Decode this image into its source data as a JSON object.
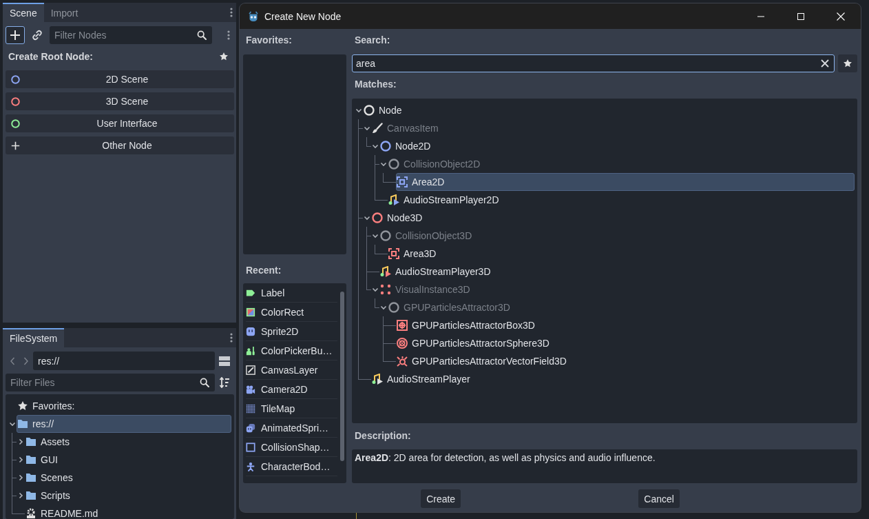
{
  "scene_dock": {
    "tabs": [
      {
        "label": "Scene",
        "selected": true
      },
      {
        "label": "Import",
        "selected": false
      }
    ],
    "add_button": {
      "focused": true
    },
    "filter": {
      "placeholder": "Filter Nodes"
    },
    "heading": "Create Root Node:",
    "root_options": [
      {
        "label": "2D Scene",
        "kind": "circle",
        "color": "#8da5f3"
      },
      {
        "label": "3D Scene",
        "kind": "circle",
        "color": "#fc7f7f"
      },
      {
        "label": "User Interface",
        "kind": "circle",
        "color": "#8eef97"
      },
      {
        "label": "Other Node",
        "kind": "plus"
      }
    ]
  },
  "filesystem_dock": {
    "tabs": [
      {
        "label": "FileSystem",
        "selected": true
      }
    ],
    "path": "res://",
    "filter": {
      "placeholder": "Filter Files"
    },
    "tree": [
      {
        "label": "Favorites:",
        "kind": "star",
        "selected": false
      },
      {
        "label": "res://",
        "kind": "folder",
        "selected": true,
        "expanded": true,
        "children": [
          {
            "label": "Assets",
            "kind": "folder",
            "selected": false,
            "expanded": false
          },
          {
            "label": "GUI",
            "kind": "folder",
            "selected": false,
            "expanded": false
          },
          {
            "label": "Scenes",
            "kind": "folder",
            "selected": false,
            "expanded": false
          },
          {
            "label": "Scripts",
            "kind": "folder",
            "selected": false,
            "expanded": false
          },
          {
            "label": "README.md",
            "kind": "gear",
            "selected": false
          }
        ]
      }
    ]
  },
  "dialog": {
    "title": "Create New Node",
    "favorites_label": "Favorites:",
    "recent_label": "Recent:",
    "recent": [
      {
        "label": "Label",
        "kind": "tag",
        "selected": false
      },
      {
        "label": "ColorRect",
        "kind": "swatch",
        "selected": false
      },
      {
        "label": "Sprite2D",
        "kind": "face",
        "selected": false
      },
      {
        "label": "ColorPickerBu…",
        "kind": "dropper",
        "selected": false
      },
      {
        "label": "CanvasLayer",
        "kind": "pencil",
        "selected": false
      },
      {
        "label": "Camera2D",
        "kind": "camera",
        "selected": false
      },
      {
        "label": "TileMap",
        "kind": "grid",
        "selected": false
      },
      {
        "label": "AnimatedSpri…",
        "kind": "faces",
        "selected": false
      },
      {
        "label": "CollisionShap…",
        "kind": "square",
        "selected": false
      },
      {
        "label": "CharacterBod…",
        "kind": "figure",
        "selected": false
      }
    ],
    "search_label": "Search:",
    "search": {
      "value": "area",
      "focused": true
    },
    "matches_label": "Matches:",
    "matches": [
      {
        "label": "Node",
        "kind": "circle",
        "color": "#e0e0e0",
        "selected": false,
        "disabled": false,
        "expanded": true,
        "children": [
          {
            "label": "CanvasItem",
            "kind": "brush",
            "color": "#e0e0e0",
            "selected": false,
            "disabled": true,
            "expanded": true,
            "children": [
              {
                "label": "Node2D",
                "kind": "circle",
                "color": "#8da5f3",
                "selected": false,
                "disabled": false,
                "expanded": true,
                "children": [
                  {
                    "label": "CollisionObject2D",
                    "kind": "circle",
                    "color": "#90949b",
                    "selected": false,
                    "disabled": true,
                    "expanded": true,
                    "children": [
                      {
                        "label": "Area2D",
                        "kind": "area",
                        "color": "#8da5f3",
                        "selected": true,
                        "disabled": false
                      }
                    ]
                  },
                  {
                    "label": "AudioStreamPlayer2D",
                    "kind": "audio",
                    "color": "#8da5f3",
                    "selected": false,
                    "disabled": false
                  }
                ]
              }
            ]
          },
          {
            "label": "Node3D",
            "kind": "circle",
            "color": "#fc7f7f",
            "selected": false,
            "disabled": false,
            "expanded": true,
            "children": [
              {
                "label": "CollisionObject3D",
                "kind": "circle",
                "color": "#90949b",
                "selected": false,
                "disabled": true,
                "expanded": true,
                "children": [
                  {
                    "label": "Area3D",
                    "kind": "area",
                    "color": "#fc7f7f",
                    "selected": false,
                    "disabled": false
                  }
                ]
              },
              {
                "label": "AudioStreamPlayer3D",
                "kind": "audio",
                "color": "#fc7f7f",
                "selected": false,
                "disabled": false
              },
              {
                "label": "VisualInstance3D",
                "kind": "dots",
                "color": "#fc7f7f",
                "selected": false,
                "disabled": true,
                "expanded": true,
                "children": [
                  {
                    "label": "GPUParticlesAttractor3D",
                    "kind": "circle",
                    "color": "#90949b",
                    "selected": false,
                    "disabled": true,
                    "expanded": true,
                    "children": [
                      {
                        "label": "GPUParticlesAttractorBox3D",
                        "kind": "boxed",
                        "color": "#fc7f7f",
                        "selected": false,
                        "disabled": false
                      },
                      {
                        "label": "GPUParticlesAttractorSphere3D",
                        "kind": "rings",
                        "color": "#fc7f7f",
                        "selected": false,
                        "disabled": false
                      },
                      {
                        "label": "GPUParticlesAttractorVectorField3D",
                        "kind": "swirl",
                        "color": "#fc7f7f",
                        "selected": false,
                        "disabled": false
                      }
                    ]
                  }
                ]
              }
            ]
          },
          {
            "label": "AudioStreamPlayer",
            "kind": "audio",
            "color": "#e0e0e0",
            "selected": false,
            "disabled": false
          }
        ]
      }
    ],
    "description_label": "Description:",
    "description": "**Area2D**: 2D area for detection, as well as physics and audio influence.",
    "buttons": [
      "Create",
      "Cancel"
    ]
  }
}
